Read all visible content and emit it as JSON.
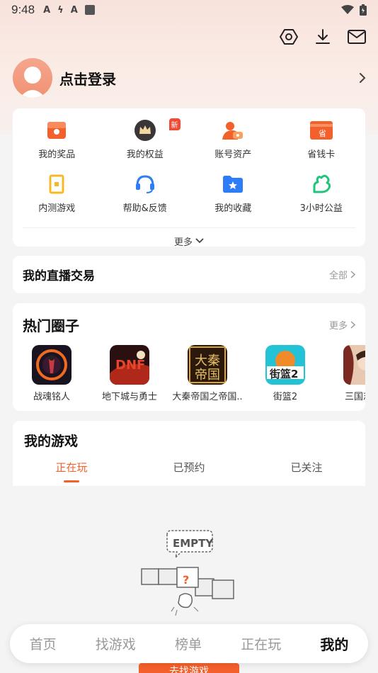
{
  "status_bar": {
    "time": "9:48",
    "notifications": [
      "A",
      "ϟ",
      "A"
    ],
    "icons": [
      "wifi-icon",
      "battery-icon"
    ]
  },
  "header_icons": [
    "settings-hexagon-icon",
    "download-icon",
    "mail-icon"
  ],
  "login": {
    "label": "点击登录"
  },
  "shortcuts": {
    "items": [
      {
        "label": "我的奖品",
        "icon": "prize-icon"
      },
      {
        "label": "我的权益",
        "icon": "crown-icon",
        "badge": "新"
      },
      {
        "label": "账号资产",
        "icon": "account-asset-icon"
      },
      {
        "label": "省钱卡",
        "icon": "saving-card-icon"
      },
      {
        "label": "内测游戏",
        "icon": "beta-game-icon"
      },
      {
        "label": "帮助&反馈",
        "icon": "headset-icon"
      },
      {
        "label": "我的收藏",
        "icon": "favorites-folder-icon"
      },
      {
        "label": "3小时公益",
        "icon": "charity-icon"
      }
    ],
    "more_label": "更多"
  },
  "live_trade": {
    "title": "我的直播交易",
    "more_label": "全部"
  },
  "hot_circles": {
    "title": "热门圈子",
    "more_label": "更多",
    "items": [
      {
        "label": "战魂铭人"
      },
      {
        "label": "地下城与勇士"
      },
      {
        "label": "大秦帝国之帝国.."
      },
      {
        "label": "街篮2"
      },
      {
        "label": "三国志幻"
      }
    ]
  },
  "my_games": {
    "title": "我的游戏",
    "tabs": [
      {
        "label": "正在玩",
        "active": true
      },
      {
        "label": "已预约",
        "active": false
      },
      {
        "label": "已关注",
        "active": false
      }
    ],
    "empty_text": "EMPTY",
    "find_button": "去找游戏"
  },
  "bottom_nav": [
    {
      "label": "首页",
      "active": false
    },
    {
      "label": "找游戏",
      "active": false
    },
    {
      "label": "榜单",
      "active": false
    },
    {
      "label": "正在玩",
      "active": false
    },
    {
      "label": "我的",
      "active": true
    }
  ],
  "colors": {
    "accent": "#f4602c",
    "badge": "#f44a35",
    "blue": "#2f7df6",
    "green": "#22c37a",
    "yellow": "#f8b823"
  }
}
